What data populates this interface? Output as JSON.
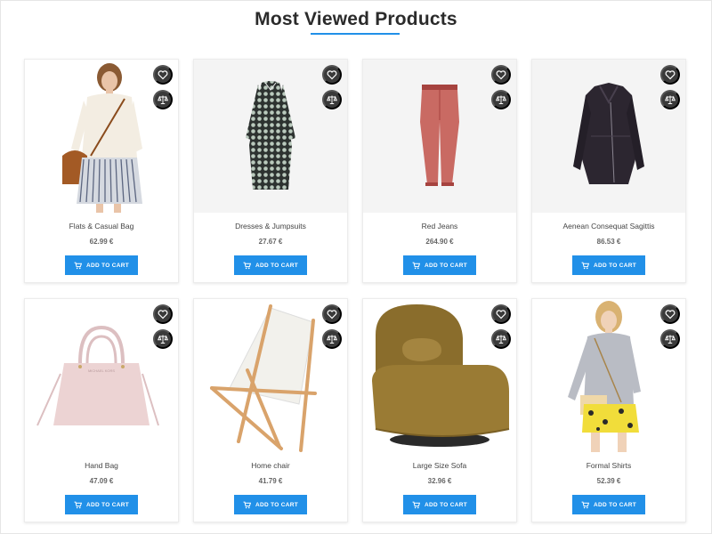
{
  "section": {
    "title": "Most Viewed Products"
  },
  "colors": {
    "accent": "#2190e8",
    "icon_bg": "#3a3a3a",
    "card_bg": "#f4f4f4"
  },
  "icons": {
    "wishlist": "heart-icon",
    "compare": "scale-icon",
    "cart": "cart-icon"
  },
  "products": [
    {
      "name": "Flats & Casual Bag",
      "price": "62.99 €",
      "cart_label": "ADD TO CART",
      "image": "woman-white-sweater"
    },
    {
      "name": "Dresses & Jumpsuits",
      "price": "27.67 €",
      "cart_label": "ADD TO CART",
      "image": "patterned-dress"
    },
    {
      "name": "Red Jeans",
      "price": "264.90 €",
      "cart_label": "ADD TO CART",
      "image": "red-trousers"
    },
    {
      "name": "Aenean Consequat Sagittis",
      "price": "86.53 €",
      "cart_label": "ADD TO CART",
      "image": "leather-jacket"
    },
    {
      "name": "Hand Bag",
      "price": "47.09 €",
      "cart_label": "ADD TO CART",
      "image": "pink-handbag"
    },
    {
      "name": "Home chair",
      "price": "41.79 €",
      "cart_label": "ADD TO CART",
      "image": "deck-chair"
    },
    {
      "name": "Large Size Sofa",
      "price": "32.96 €",
      "cart_label": "ADD TO CART",
      "image": "armchair"
    },
    {
      "name": "Formal Shirts",
      "price": "52.39 €",
      "cart_label": "ADD TO CART",
      "image": "woman-grey-shirt"
    }
  ]
}
